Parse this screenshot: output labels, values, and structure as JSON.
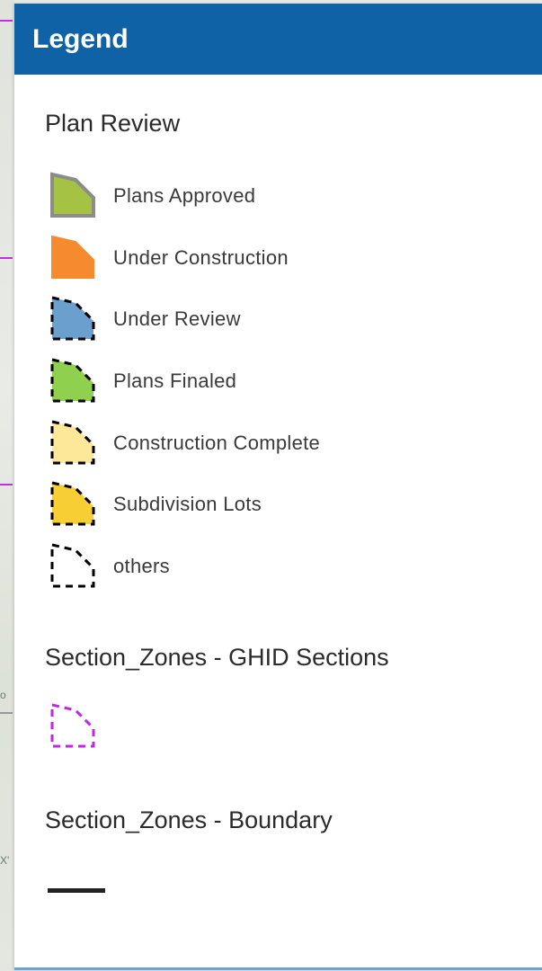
{
  "legend": {
    "title": "Legend",
    "sections": [
      {
        "title": "Plan Review",
        "items": [
          {
            "label": "Plans Approved",
            "fill": "#a6c244",
            "stroke": "#8c8c8c",
            "dashed": false
          },
          {
            "label": "Under Construction",
            "fill": "#f68a2e",
            "stroke": "#f68a2e",
            "dashed": false
          },
          {
            "label": "Under Review",
            "fill": "#6b9fce",
            "stroke": "#000000",
            "dashed": true
          },
          {
            "label": "Plans Finaled",
            "fill": "#8fd04e",
            "stroke": "#000000",
            "dashed": true
          },
          {
            "label": "Construction Complete",
            "fill": "#fde89a",
            "stroke": "#000000",
            "dashed": true
          },
          {
            "label": "Subdivision Lots",
            "fill": "#f7cf35",
            "stroke": "#000000",
            "dashed": true
          },
          {
            "label": "others",
            "fill": "none",
            "stroke": "#000000",
            "dashed": true
          }
        ]
      },
      {
        "title": "Section_Zones - GHID Sections",
        "swatch": {
          "fill": "none",
          "stroke": "#c026e8",
          "dashed": true
        }
      },
      {
        "title": "Section_Zones - Boundary",
        "swatch": {
          "line_color": "#222222"
        }
      }
    ]
  },
  "map_strip_text": [
    "o",
    "X'"
  ]
}
